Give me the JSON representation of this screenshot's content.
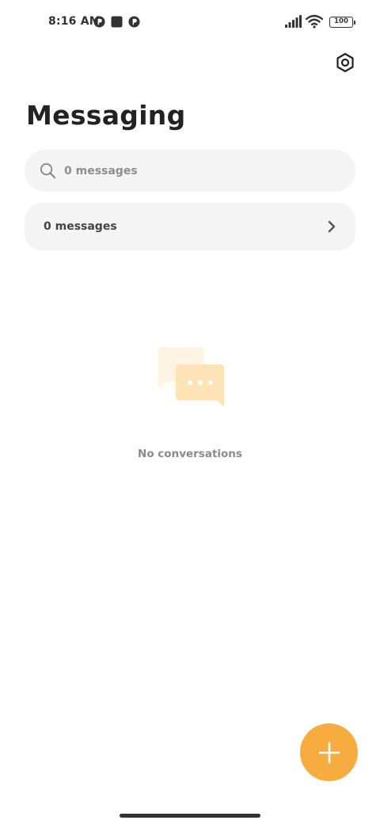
{
  "status_bar": {
    "time": "8:16 AM",
    "battery": "100",
    "notification_icons": [
      "app-notification-icon",
      "square-notification-icon",
      "app-notification-icon"
    ],
    "icons": [
      "signal-icon",
      "wifi-icon",
      "battery-icon"
    ]
  },
  "header": {
    "title": "Messaging",
    "settings_icon": "hexagon-gear-icon"
  },
  "search": {
    "placeholder": "0 messages",
    "icon": "search-icon"
  },
  "messages_row": {
    "label": "0 messages",
    "icon": "chevron-right-icon"
  },
  "empty_state": {
    "text": "No conversations",
    "illustration": "chat-bubbles-icon"
  },
  "fab": {
    "icon": "plus-icon"
  },
  "colors": {
    "accent": "#f6ac3f",
    "accent_light": "#fde3b5",
    "surface": "#f4f4f4",
    "text_primary": "#222222",
    "text_secondary": "#8a8a8a"
  }
}
